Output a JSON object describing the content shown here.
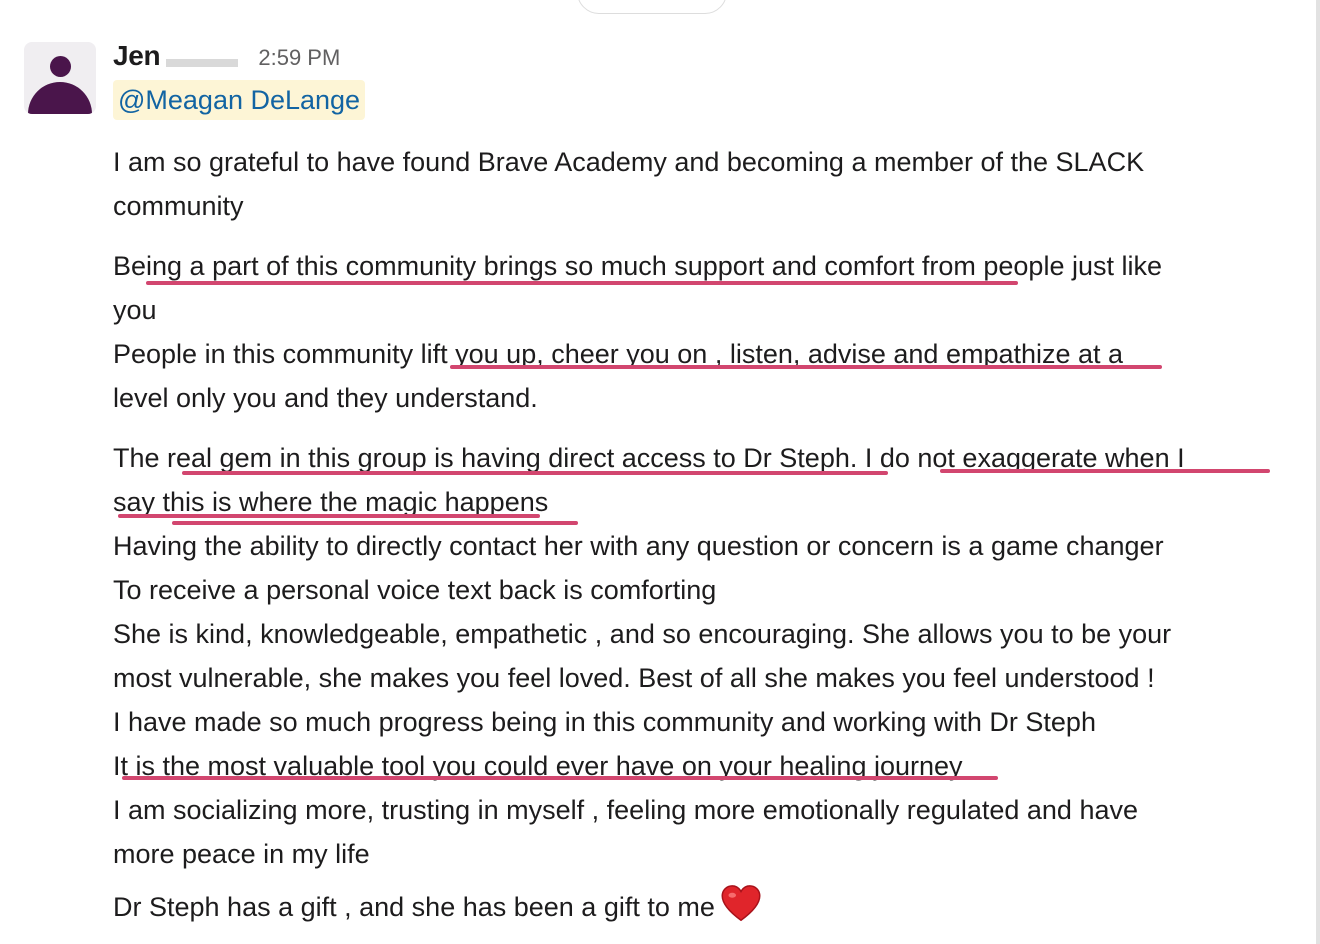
{
  "message": {
    "sender": "Jen",
    "timestamp": "2:59 PM",
    "mention": "@Meagan DeLange",
    "paragraphs": [
      [
        "I am so grateful to have found Brave Academy and becoming a member of the SLACK",
        "community"
      ],
      [
        "Being a part of this community brings so much support and comfort from people just like",
        "you",
        "People in this community lift you up, cheer you on , listen, advise and empathize at a",
        "level only you and they understand."
      ],
      [
        "The real gem in this group is having direct access to Dr Steph. I do not exaggerate when I",
        "say this is where the magic happens",
        "Having the ability to directly contact her with any question or concern is a game changer",
        "To receive a personal voice text back is comforting",
        "She is kind, knowledgeable, empathetic , and so encouraging. She allows you to be your",
        "most vulnerable, she makes you feel loved. Best of all she makes you feel understood !",
        "I have made so much progress being in this community and working with Dr Steph",
        "It is the most valuable tool you could ever have on your healing journey",
        "I am socializing more, trusting in myself , feeling more emotionally regulated and have",
        "more peace in my life",
        "Dr Steph has a gift , and she has been a gift to me"
      ]
    ],
    "reaction_emoji": "heart-emoji"
  },
  "colors": {
    "mention_bg": "#fdf5d6",
    "mention_text": "#1264a3",
    "underline": "#d2466f",
    "avatar": "#4a154b"
  }
}
